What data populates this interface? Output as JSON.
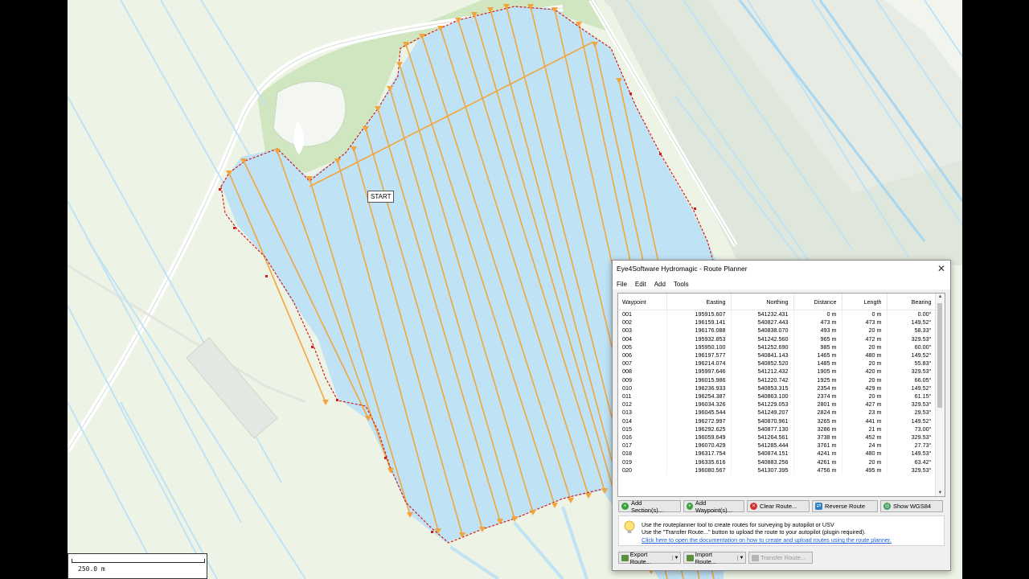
{
  "map": {
    "start_label": "START",
    "scale_label": "250.0 m",
    "colors": {
      "water": "#bfe3f5",
      "land": "#edf4e6",
      "route": "#f3a53a",
      "boundary": "#d41b1b"
    }
  },
  "window": {
    "title": "Eye4Software Hydromagic - Route Planner",
    "close_glyph": "✕",
    "menu": [
      "File",
      "Edit",
      "Add",
      "Tools"
    ]
  },
  "table": {
    "columns": [
      "Waypoint",
      "Easting",
      "Northing",
      "Distance",
      "Length",
      "Bearing"
    ],
    "rows": [
      [
        "001",
        "195915.607",
        "541232.431",
        "0 m",
        "0 m",
        "0.00°"
      ],
      [
        "002",
        "196159.141",
        "540827.443",
        "473 m",
        "473 m",
        "149.52°"
      ],
      [
        "003",
        "196176.088",
        "540838.070",
        "493 m",
        "20 m",
        "58.33°"
      ],
      [
        "004",
        "195932.853",
        "541242.560",
        "965 m",
        "472 m",
        "329.53°"
      ],
      [
        "005",
        "195950.100",
        "541252.690",
        "985 m",
        "20 m",
        "60.00°"
      ],
      [
        "006",
        "196197.577",
        "540841.143",
        "1465 m",
        "480 m",
        "149.52°"
      ],
      [
        "007",
        "196214.074",
        "540852.520",
        "1485 m",
        "20 m",
        "55.83°"
      ],
      [
        "008",
        "195997.646",
        "541212.432",
        "1905 m",
        "420 m",
        "329.53°"
      ],
      [
        "009",
        "196015.986",
        "541220.742",
        "1925 m",
        "20 m",
        "66.05°"
      ],
      [
        "010",
        "196236.933",
        "540853.315",
        "2354 m",
        "429 m",
        "149.52°"
      ],
      [
        "011",
        "196254.387",
        "540863.100",
        "2374 m",
        "20 m",
        "61.15°"
      ],
      [
        "012",
        "196034.326",
        "541229.053",
        "2801 m",
        "427 m",
        "329.53°"
      ],
      [
        "013",
        "196045.544",
        "541249.207",
        "2824 m",
        "23 m",
        "29.53°"
      ],
      [
        "014",
        "196272.997",
        "540870.961",
        "3265 m",
        "441 m",
        "149.52°"
      ],
      [
        "015",
        "196292.625",
        "540877.130",
        "3286 m",
        "21 m",
        "73.00°"
      ],
      [
        "016",
        "196059.649",
        "541264.561",
        "3738 m",
        "452 m",
        "329.53°"
      ],
      [
        "017",
        "196070.429",
        "541285.444",
        "3761 m",
        "24 m",
        "27.73°"
      ],
      [
        "018",
        "196317.754",
        "540874.151",
        "4241 m",
        "480 m",
        "149.53°"
      ],
      [
        "019",
        "196335.616",
        "540883.256",
        "4261 m",
        "20 m",
        "63.42°"
      ],
      [
        "020",
        "196080.567",
        "541307.395",
        "4756 m",
        "495 m",
        "329.53°"
      ]
    ]
  },
  "buttons": {
    "add_sections": "Add Section(s)...",
    "add_waypoints": "Add Waypoint(s)...",
    "clear_route": "Clear Route...",
    "reverse_route": "Reverse Route",
    "show_wgs84": "Show WGS84"
  },
  "info": {
    "line1": "Use the routeplanner tool to create routes for surveying by autopilot or USV",
    "line2": "Use the \"Transfer Route...\" button to upload the route to your autopilot (plugin required).",
    "link": "Click here to open the documentation on how to create and upload routes using the route planner."
  },
  "bottom_buttons": {
    "export": "Export Route...",
    "import": "Import Route...",
    "transfer": "Transfer Route..."
  }
}
